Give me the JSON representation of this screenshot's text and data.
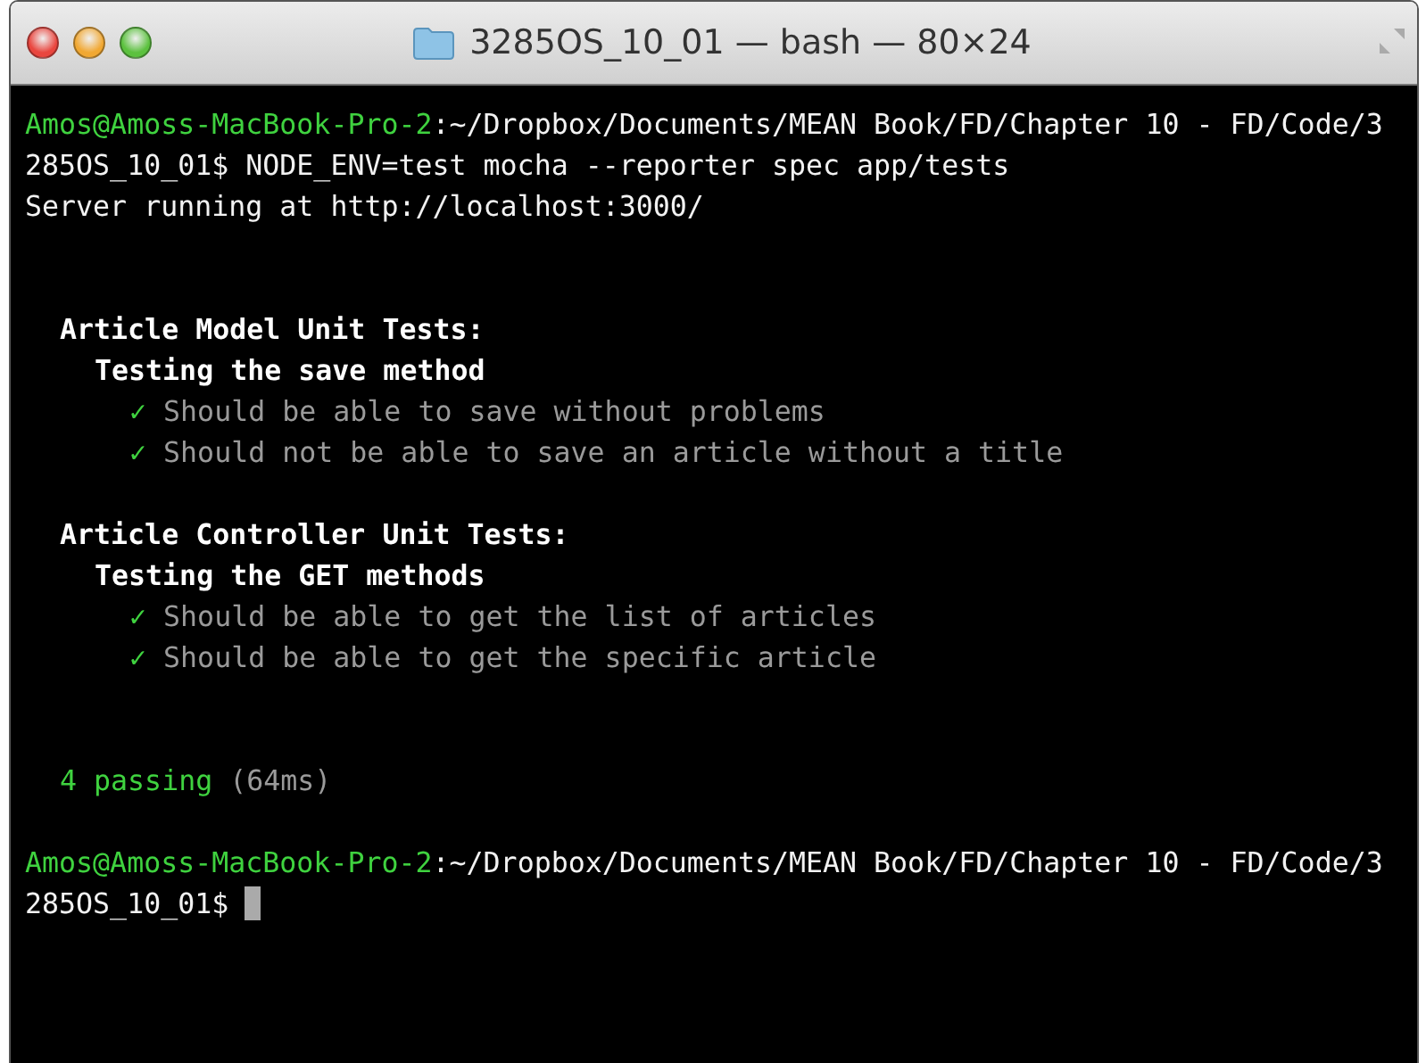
{
  "window": {
    "title": "3285OS_10_01 — bash — 80×24"
  },
  "terminal": {
    "lines": [
      {
        "kind": "prompt",
        "user": "Amos@Amoss-MacBook-Pro-2",
        "path": ":~/Dropbox/Documents/MEAN Book/FD/Chapter 10 - FD/Code/3"
      },
      {
        "kind": "output",
        "text": "285OS_10_01$ NODE_ENV=test mocha --reporter spec app/tests"
      },
      {
        "kind": "output",
        "text": "Server running at http://localhost:3000/"
      },
      {
        "kind": "blank"
      },
      {
        "kind": "blank"
      },
      {
        "kind": "suite",
        "title": "Article Model Unit Tests:",
        "children": [
          {
            "kind": "suite",
            "title": "Testing the save method",
            "children": [
              {
                "kind": "test",
                "mark": "✓",
                "title": "Should be able to save without problems"
              },
              {
                "kind": "test",
                "mark": "✓",
                "title": "Should not be able to save an article without a title"
              }
            ]
          }
        ]
      },
      {
        "kind": "blank"
      },
      {
        "kind": "suite",
        "title": "Article Controller Unit Tests:",
        "children": [
          {
            "kind": "suite",
            "title": "Testing the GET methods",
            "children": [
              {
                "kind": "test",
                "mark": "✓",
                "title": "Should be able to get the list of articles"
              },
              {
                "kind": "test",
                "mark": "✓",
                "title": "Should be able to get the specific article"
              }
            ]
          }
        ]
      },
      {
        "kind": "blank"
      },
      {
        "kind": "blank"
      },
      {
        "kind": "summary",
        "count": "4 passing",
        "duration": "(64ms)"
      },
      {
        "kind": "blank"
      },
      {
        "kind": "prompt",
        "user": "Amos@Amoss-MacBook-Pro-2",
        "path": ":~/Dropbox/Documents/MEAN Book/FD/Chapter 10 - FD/Code/3"
      },
      {
        "kind": "output",
        "text": "285OS_10_01$",
        "cursor": true
      }
    ]
  }
}
